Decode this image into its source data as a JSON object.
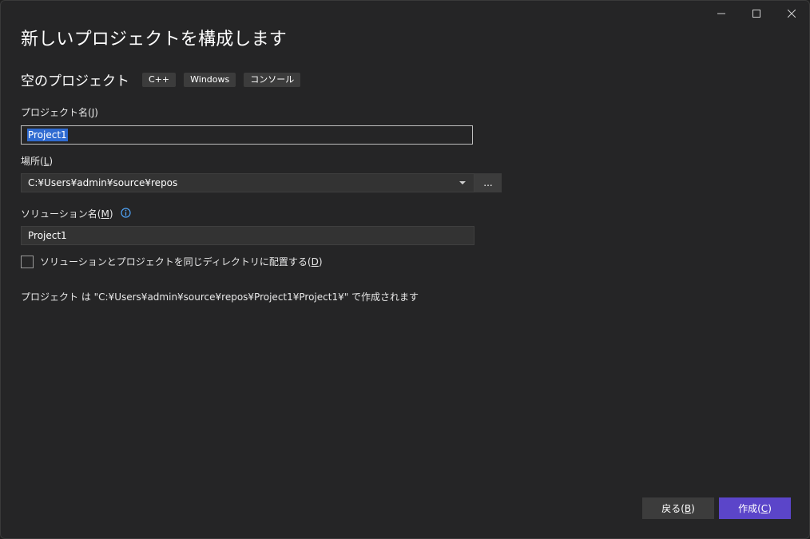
{
  "window": {
    "controls": {
      "minimize": "minimize-icon",
      "maximize": "maximize-icon",
      "close": "close-icon"
    }
  },
  "page": {
    "title": "新しいプロジェクトを構成します"
  },
  "template": {
    "name": "空のプロジェクト",
    "tags": [
      "C++",
      "Windows",
      "コンソール"
    ]
  },
  "project_name": {
    "label": "プロジェクト名(",
    "accel": "J",
    "label_end": ")",
    "value": "Project1"
  },
  "location": {
    "label": "場所(",
    "accel": "L",
    "label_end": ")",
    "value": "C:¥Users¥admin¥source¥repos",
    "browse_label": "..."
  },
  "solution_name": {
    "label": "ソリューション名(",
    "accel": "M",
    "label_end": ")",
    "value": "Project1",
    "info_icon": "info-icon"
  },
  "same_dir": {
    "label": "ソリューションとプロジェクトを同じディレクトリに配置する(",
    "accel": "D",
    "label_end": ")",
    "checked": false
  },
  "path_note": "プロジェクト は \"C:¥Users¥admin¥source¥repos¥Project1¥Project1¥\" で作成されます",
  "footer": {
    "back_label": "戻る(",
    "back_accel": "B",
    "back_end": ")",
    "create_label": "作成(",
    "create_accel": "C",
    "create_end": ")"
  },
  "colors": {
    "window_bg": "#252526",
    "input_bg": "#333333",
    "tag_bg": "#3c3c3c",
    "selection": "#2f6bd1",
    "accent_button": "#5b45c9",
    "info_icon": "#4fa3f7"
  }
}
